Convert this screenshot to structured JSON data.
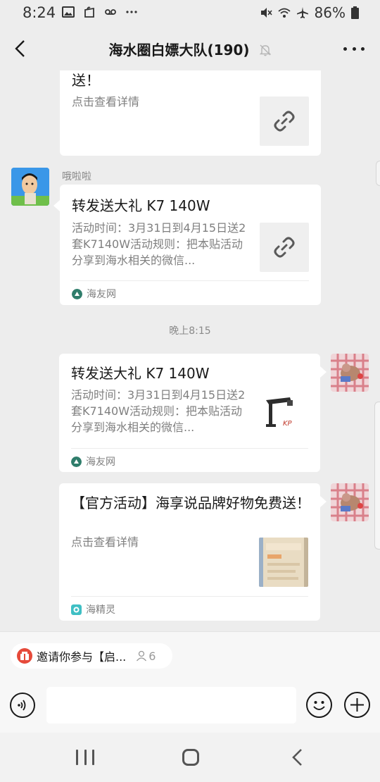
{
  "status_bar": {
    "time": "8:24",
    "battery": "86%",
    "left_icons": [
      "image-icon",
      "bag-icon",
      "voicemail-icon",
      "more-dots-icon"
    ],
    "right_icons": [
      "mute-icon",
      "wifi-icon",
      "airplane-icon",
      "battery-icon"
    ]
  },
  "header": {
    "title": "海水圈白嫖大队(190)",
    "back_icon": "chevron-left-icon",
    "mute_icon": "bell-off-icon",
    "more_icon": "more-icon"
  },
  "messages": [
    {
      "type": "link-card",
      "side": "left",
      "title": "送！",
      "desc": "点击查看详情",
      "thumb": "link-icon"
    },
    {
      "type": "link-card",
      "side": "left",
      "sender": "哦啦啦",
      "title": "转发送大礼 K7 140W",
      "desc": "活动时间：3月31日到4月15日送2套K7140W活动规则：把本贴活动分享到海水相关的微信...",
      "thumb": "link-icon",
      "source": "海友网"
    },
    {
      "type": "timestamp",
      "text": "晚上8:15"
    },
    {
      "type": "link-card",
      "side": "right",
      "title": "转发送大礼 K7 140W",
      "desc": "活动时间：3月31日到4月15日送2套K7140W活动规则：把本贴活动分享到海水相关的微信...",
      "thumb": "product-image",
      "source": "海友网"
    },
    {
      "type": "link-card",
      "side": "right",
      "title": "【官方活动】海享说品牌好物免费送！",
      "desc": "点击查看详情",
      "thumb": "blurred-image",
      "source": "海精灵"
    }
  ],
  "invite_chip": {
    "text": "邀请你参与【启...",
    "count": "6"
  },
  "input": {
    "placeholder": "",
    "value": ""
  },
  "colors": {
    "background": "#ededed",
    "card": "#ffffff",
    "invite_red": "#e64a3a",
    "haiyou_green": "#2f7d6b",
    "haijingling_teal": "#3fbfc4"
  }
}
